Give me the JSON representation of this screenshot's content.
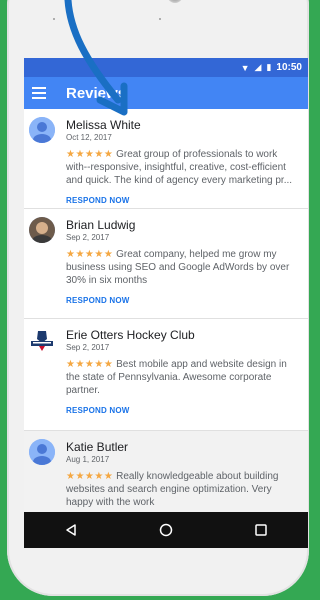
{
  "status_bar": {
    "time": "10:50",
    "icons": [
      "wifi-icon",
      "signal-icon",
      "battery-icon"
    ]
  },
  "app_bar": {
    "title": "Reviews",
    "menu_icon": "hamburger-menu-icon"
  },
  "reviews": [
    {
      "name": "Melissa White",
      "date": "Oct 12, 2017",
      "stars": "★★★★★",
      "rating": 5,
      "text": "Great group of professionals to work with--responsive, insightful, creative, cost-efficient and quick. The kind of agency every marketing pr...",
      "respond_label": "RESPOND NOW",
      "avatar": "default-avatar-icon"
    },
    {
      "name": "Brian Ludwig",
      "date": "Sep 2, 2017",
      "stars": "★★★★★",
      "rating": 5,
      "text": "Great company, helped me grow my business using SEO and Google AdWords by over 30% in six months",
      "respond_label": "RESPOND NOW",
      "avatar": "photo-avatar"
    },
    {
      "name": "Erie Otters Hockey Club",
      "date": "Sep 2, 2017",
      "stars": "★★★★★",
      "rating": 5,
      "text": "Best mobile app and website design in the state of Pennsylvania. Awesome corporate partner.",
      "respond_label": "RESPOND NOW",
      "avatar": "hockey-logo-avatar"
    },
    {
      "name": "Katie Butler",
      "date": "Aug 1, 2017",
      "stars": "★★★★★",
      "rating": 5,
      "text": "Really knowledgeable about building websites and search engine optimization. Very happy with the work",
      "respond_label": "",
      "avatar": "default-avatar-icon"
    }
  ],
  "nav_bar": {
    "buttons": [
      "back-icon",
      "home-icon",
      "recents-icon"
    ]
  },
  "colors": {
    "background": "#34a853",
    "app_bar": "#4285f4",
    "status_bar": "#3367d6",
    "stars": "#f4a742",
    "link": "#1a73e8",
    "arrow": "#1a6fc4"
  }
}
